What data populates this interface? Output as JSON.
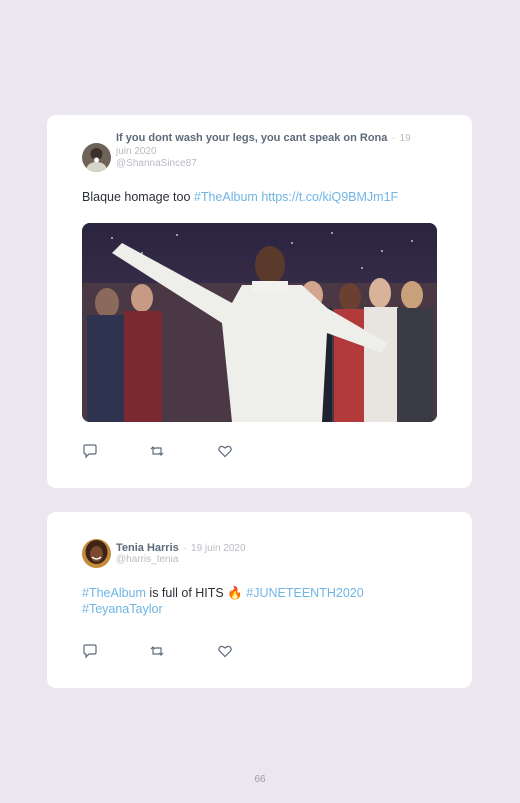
{
  "tweets": [
    {
      "name": "If you dont wash your legs, you cant speak on Rona",
      "separator": "·",
      "date_line1": "19",
      "date_line2": "juin 2020",
      "handle": "@ShannaSince87",
      "text_plain": "Blaque homage too ",
      "hashtag": "#TheAlbum",
      "url": "https://t.co/kiQ9BMJm1F",
      "has_media": true,
      "avatar_icon": "profile-photo"
    },
    {
      "name": "Tenia Harris",
      "separator": "·",
      "date": "19 juin 2020",
      "handle": "@harris_tenia",
      "hashtag1": "#TheAlbum",
      "text_plain": " is full of HITS ",
      "emoji": "🔥",
      "hashtag2": "#JUNETEENTH2020",
      "hashtag3": "#TeyanaTaylor",
      "avatar_icon": "profile-photo"
    }
  ],
  "actions": {
    "reply_icon": "reply-icon",
    "retweet_icon": "retweet-icon",
    "like_icon": "heart-icon",
    "icon_color": "#5d6a7a"
  },
  "page_number": "66",
  "colors": {
    "background": "#ebe6ef",
    "card": "#ffffff",
    "link": "#6fb5e6",
    "name": "#5d6a7a",
    "meta": "#b7bcc3"
  }
}
